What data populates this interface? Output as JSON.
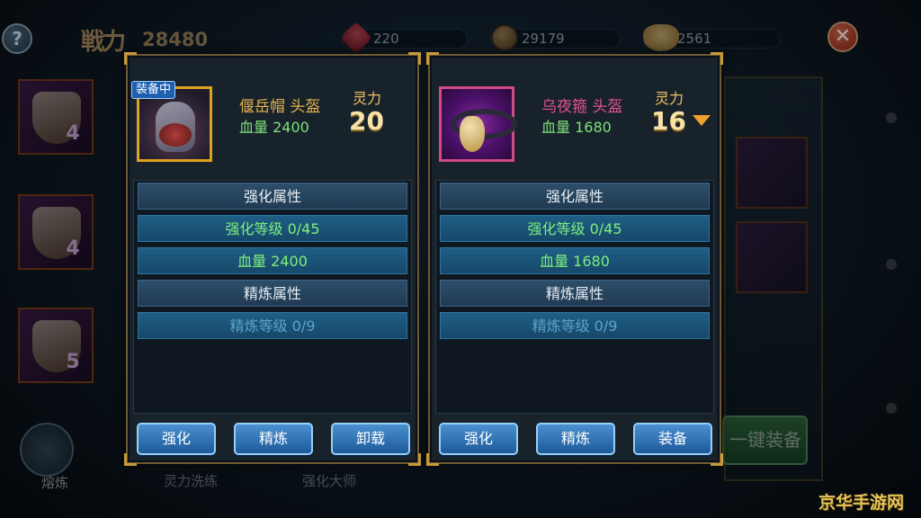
{
  "topbar": {
    "help_label": "?",
    "power_label": "戦力",
    "power_value": "28480",
    "gems": "220",
    "coins": "29179",
    "ingots": "2561",
    "close_label": "✕"
  },
  "background": {
    "slot_levels": [
      "4",
      "4",
      "5"
    ],
    "forge_label": "熔炼",
    "tabs": [
      "灵力洗练",
      "强化大师"
    ],
    "one_key_equip": "一键装备"
  },
  "left_panel": {
    "badge": "装备中",
    "item_name": "偃岳帽 头盔",
    "hp": "血量 2400",
    "spirit_label": "灵力",
    "spirit_value": "20",
    "attrs": {
      "enhance_header": "强化属性",
      "enhance_level": "强化等级  0/45",
      "enhance_hp": "血量 2400",
      "refine_header": "精炼属性",
      "refine_level": "精炼等级  0/9"
    },
    "buttons": [
      "强化",
      "精炼",
      "卸载"
    ]
  },
  "right_panel": {
    "item_name": "乌夜箍 头盔",
    "hp": "血量 1680",
    "spirit_label": "灵力",
    "spirit_value": "16",
    "attrs": {
      "enhance_header": "强化属性",
      "enhance_level": "强化等级  0/45",
      "enhance_hp": "血量 1680",
      "refine_header": "精炼属性",
      "refine_level": "精炼等级  0/9"
    },
    "buttons": [
      "强化",
      "精炼",
      "装备"
    ]
  },
  "watermark": "京华手游网"
}
